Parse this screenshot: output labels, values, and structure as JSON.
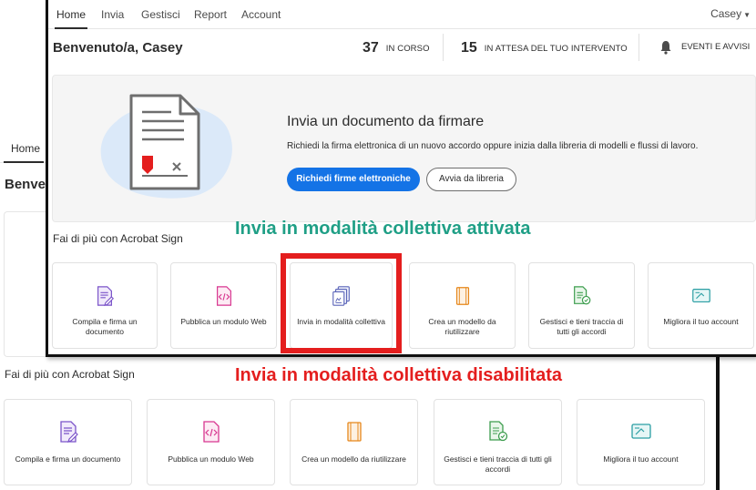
{
  "colors": {
    "accent": "#1473e6",
    "highlight": "#e41e1e",
    "annotation_enabled": "#1f9f86",
    "annotation_disabled": "#e41e1e",
    "icon_purple": "#7b54c9",
    "icon_pink": "#d83790",
    "icon_orange": "#e68619",
    "icon_green": "#3d9d4e",
    "icon_teal": "#2b9ea3"
  },
  "enabled_view": {
    "nav": {
      "items": [
        "Home",
        "Invia",
        "Gestisci",
        "Report",
        "Account"
      ],
      "active": "Home",
      "user": "Casey"
    },
    "welcome": "Benvenuto/a, Casey",
    "stats": [
      {
        "count": "37",
        "label": "IN CORSO"
      },
      {
        "count": "15",
        "label": "IN ATTESA DEL TUO INTERVENTO"
      }
    ],
    "events_label": "EVENTI E AVVISI",
    "hero": {
      "title": "Invia un documento da firmare",
      "description": "Richiedi la firma elettronica di un nuovo accordo oppure inizia dalla libreria di modelli e flussi di lavoro.",
      "primary_button": "Richiedi firme elettroniche",
      "secondary_button": "Avvia da libreria"
    },
    "section_title": "Fai di più con Acrobat Sign",
    "cards": [
      {
        "label": "Compila e firma un documento",
        "icon": "fill-sign-icon"
      },
      {
        "label": "Pubblica un modulo Web",
        "icon": "web-form-icon"
      },
      {
        "label": "Invia in modalità collettiva",
        "icon": "bulk-send-icon"
      },
      {
        "label": "Crea un modello da riutilizzare",
        "icon": "template-icon"
      },
      {
        "label": "Gestisci e tieni traccia di tutti gli accordi",
        "icon": "manage-icon"
      },
      {
        "label": "Migliora il tuo account",
        "icon": "upgrade-icon"
      }
    ]
  },
  "disabled_view": {
    "tab": "Home",
    "welcome_partial": "Benve",
    "section_title": "Fai di più con Acrobat Sign",
    "cards": [
      {
        "label": "Compila e firma un documento",
        "icon": "fill-sign-icon"
      },
      {
        "label": "Pubblica un modulo Web",
        "icon": "web-form-icon"
      },
      {
        "label": "Crea un modello da riutilizzare",
        "icon": "template-icon"
      },
      {
        "label": "Gestisci e tieni traccia di tutti gli accordi",
        "icon": "manage-icon"
      },
      {
        "label": "Migliora il tuo account",
        "icon": "upgrade-icon"
      }
    ]
  },
  "annotations": {
    "enabled": "Invia in modalità collettiva attivata",
    "disabled": "Invia in modalità collettiva disabilitata"
  }
}
